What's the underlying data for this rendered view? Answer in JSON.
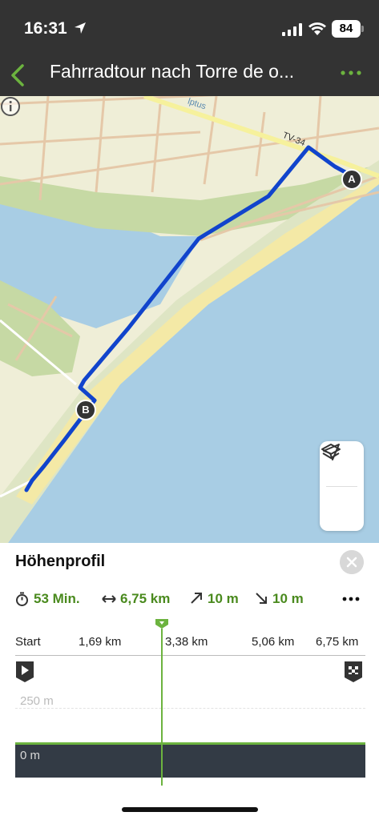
{
  "status_bar": {
    "time": "16:31",
    "battery": "84"
  },
  "nav": {
    "title": "Fahrradtour nach Torre de o..."
  },
  "map": {
    "road_labels": [
      "TV-34",
      "lptus"
    ],
    "markers": {
      "start": "A",
      "end": "B"
    },
    "colors": {
      "water": "#a8cde4",
      "land": "#efeed7",
      "green": "#c6d9a4",
      "route": "#1144cc",
      "beach": "#f4e9a6"
    }
  },
  "profile": {
    "title": "Höhenprofil",
    "stats": {
      "duration": "53 Min.",
      "distance": "6,75 km",
      "ascent": "10 m",
      "descent": "10 m"
    },
    "x_axis": [
      "Start",
      "1,69 km",
      "3,38 km",
      "5,06 km",
      "6,75 km"
    ],
    "y_labels": {
      "top": "250 m",
      "bottom": "0 m"
    },
    "accent": "#4a8a1e"
  }
}
